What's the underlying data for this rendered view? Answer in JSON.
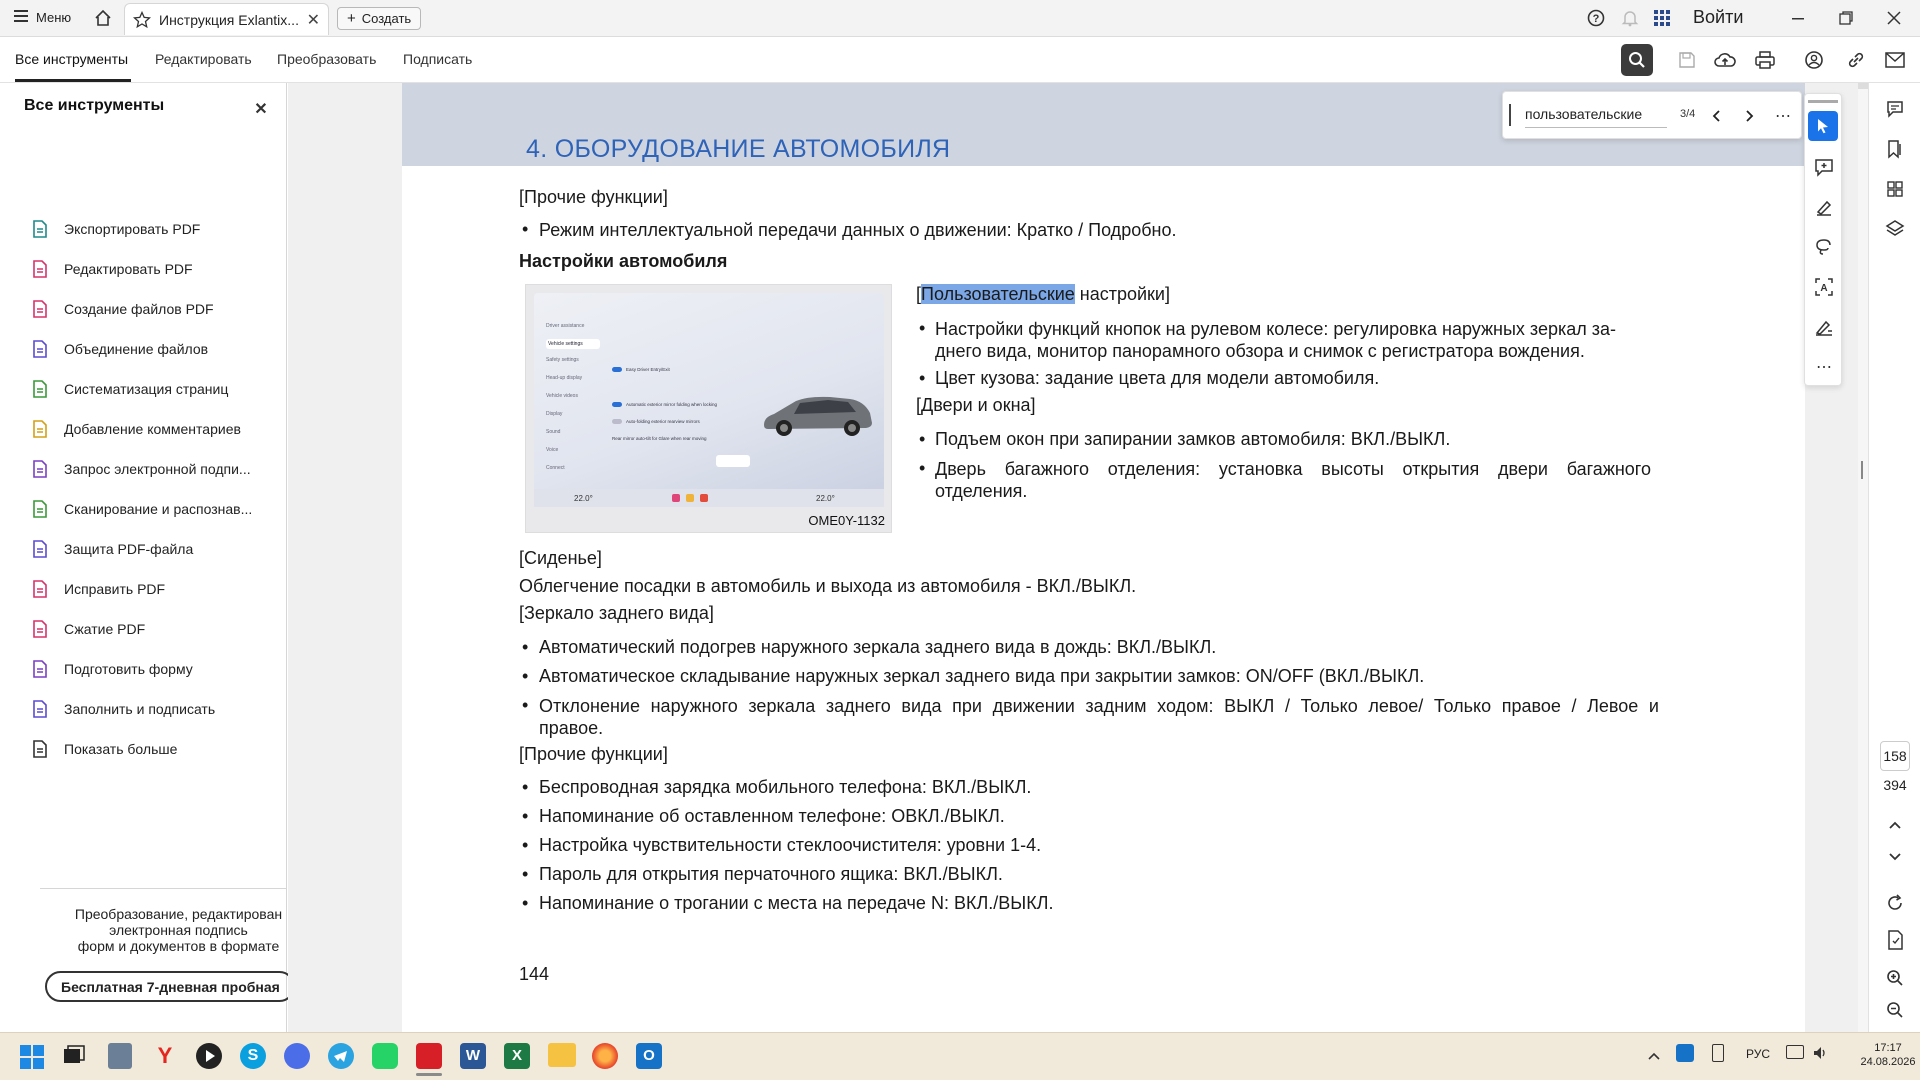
{
  "titlebar": {
    "menu_label": "Меню",
    "tab_title": "Инструкция Exlantix...",
    "create_label": "Создать",
    "signin_label": "Войти"
  },
  "toolbar": {
    "items": [
      "Все инструменты",
      "Редактировать",
      "Преобразовать",
      "Подписать"
    ]
  },
  "sidebar": {
    "title": "Все инструменты",
    "items": [
      {
        "label": "Экспортировать PDF",
        "icon": "export-pdf-icon",
        "color": "#1f8a8a"
      },
      {
        "label": "Редактировать PDF",
        "icon": "edit-pdf-icon",
        "color": "#d6336c"
      },
      {
        "label": "Создание файлов PDF",
        "icon": "create-pdf-icon",
        "color": "#d6336c"
      },
      {
        "label": "Объединение файлов",
        "icon": "combine-files-icon",
        "color": "#5b4bd1"
      },
      {
        "label": "Систематизация страниц",
        "icon": "organize-pages-icon",
        "color": "#3a9a3a"
      },
      {
        "label": "Добавление комментариев",
        "icon": "comment-icon",
        "color": "#d4a017"
      },
      {
        "label": "Запрос электронной подпи...",
        "icon": "request-signature-icon",
        "color": "#7b3fc4"
      },
      {
        "label": "Сканирование и распознав...",
        "icon": "scan-ocr-icon",
        "color": "#3a9a3a"
      },
      {
        "label": "Защита PDF-файла",
        "icon": "protect-pdf-icon",
        "color": "#5b4bd1"
      },
      {
        "label": "Исправить PDF",
        "icon": "redact-pdf-icon",
        "color": "#d6336c"
      },
      {
        "label": "Сжатие PDF",
        "icon": "compress-pdf-icon",
        "color": "#d6336c"
      },
      {
        "label": "Подготовить форму",
        "icon": "prepare-form-icon",
        "color": "#7b3fc4"
      },
      {
        "label": "Заполнить и подписать",
        "icon": "fill-sign-icon",
        "color": "#5b4bd1"
      },
      {
        "label": "Показать больше",
        "icon": "more-tools-icon",
        "color": "#333333"
      }
    ],
    "promo_lines": [
      "Преобразование, редактирован",
      "электронная подпись",
      "форм и документов в формате"
    ],
    "trial_button": "Бесплатная 7-дневная пробная"
  },
  "search": {
    "value": "пользовательские",
    "count": "3/4"
  },
  "page": {
    "header": "4. ОБОРУДОВАНИЕ АВТОМОБИЛЯ",
    "section1": "[Прочие функции]",
    "bullet1": "Режим интеллектуальной передачи данных о движении: Кратко / Подробно.",
    "subheading": "Настройки автомобиля",
    "image_caption": "OME0Y-1132",
    "screen_menu": [
      "Driver assistance",
      "Vehicle settings",
      "Safety settings",
      "Head-up display",
      "Vehicle videos",
      "Display",
      "Sound",
      "Voice",
      "Connect"
    ],
    "screen_options": [
      "Easy Driver Entry/Exit",
      "Automatic exterior mirror folding when locking",
      "Auto-folding exterior rearview mirrors",
      "Rear mirror auto-tilt for Glare when rear moving"
    ],
    "screen_temp_left": "22.0°",
    "screen_temp_right": "22.0°",
    "custom_highlight": "Пользовательские",
    "custom_rest": " настройки]",
    "custom_open": "[",
    "right_bullets": [
      [
        "Настройки функций кнопок на рулевом колесе: регулировка наружных зеркал за-",
        "днего вида, монитор панорамного обзора и снимок с регистратора вождения."
      ],
      [
        "Цвет кузова: задание цвета для модели автомобиля."
      ]
    ],
    "doors_title": "[Двери и окна]",
    "doors_bullets": [
      [
        "Подъем окон при запирании замков автомобиля: ВКЛ./ВЫКЛ."
      ],
      [
        "Дверь багажного отделения: установка высоты открытия двери багажного",
        "отделения."
      ]
    ],
    "seat_title": "[Сиденье]",
    "seat_text": "Облегчение посадки в автомобиль и выхода из автомобиля - ВКЛ./ВЫКЛ.",
    "mirror_title": "[Зеркало заднего вида]",
    "mirror_bullets": [
      [
        "Автоматический подогрев наружного зеркала заднего вида в дождь: ВКЛ./ВЫКЛ."
      ],
      [
        "Автоматическое складывание наружных зеркал заднего вида при закрытии замков: ON/OFF (ВКЛ./ВЫКЛ."
      ],
      [
        "Отклонение наружного зеркала заднего вида при движении задним ходом: ВЫКЛ / Только левое/ Только правое / Левое и",
        "правое."
      ]
    ],
    "other_title": "[Прочие функции]",
    "other_bullets": [
      "Беспроводная зарядка мобильного телефона: ВКЛ./ВЫКЛ.",
      "Напоминание об оставленном телефоне: ОВКЛ./ВЫКЛ.",
      "Настройка чувствительности стеклоочистителя: уровни 1-4.",
      "Пароль для открытия перчаточного ящика: ВКЛ./ВЫКЛ.",
      "Напоминание о трогании с места на передаче N: ВКЛ./ВЫКЛ."
    ],
    "page_number": "144"
  },
  "pagenav": {
    "current": "158",
    "total": "394"
  },
  "taskbar": {
    "lang": "РУС",
    "time": "17:17",
    "date": "24.08.2026"
  }
}
